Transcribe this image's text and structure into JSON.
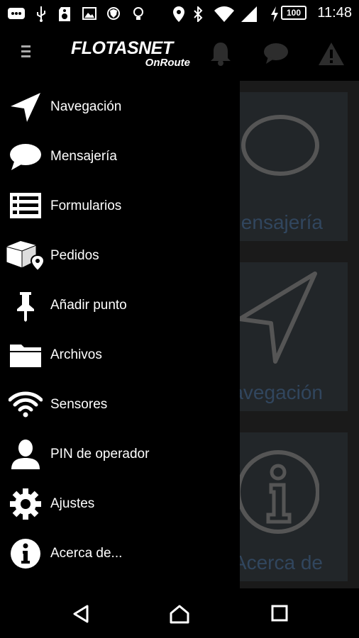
{
  "status_bar": {
    "time": "11:48",
    "battery": "100",
    "icons": [
      "messenger-icon",
      "usb-icon",
      "sd-card-icon",
      "image-icon",
      "shield-icon",
      "lightbulb-icon",
      "location-icon",
      "bluetooth-icon",
      "wifi-icon",
      "signal-icon",
      "charging-icon"
    ]
  },
  "app_bar": {
    "logo_main": "FLOTASNET",
    "logo_sub": "OnRoute",
    "icons": [
      "menu-icon",
      "bell-icon",
      "chat-icon",
      "warning-icon"
    ]
  },
  "drawer": {
    "items": [
      {
        "label": "Navegación",
        "icon": "navigation-arrow-icon"
      },
      {
        "label": "Mensajería",
        "icon": "chat-bubble-icon"
      },
      {
        "label": "Formularios",
        "icon": "form-list-icon"
      },
      {
        "label": "Pedidos",
        "icon": "package-location-icon"
      },
      {
        "label": "Añadir punto",
        "icon": "pin-icon"
      },
      {
        "label": "Archivos",
        "icon": "folder-icon"
      },
      {
        "label": "Sensores",
        "icon": "wifi-sensor-icon"
      },
      {
        "label": "PIN de operador",
        "icon": "user-icon"
      },
      {
        "label": "Ajustes",
        "icon": "gear-icon"
      },
      {
        "label": "Acerca de...",
        "icon": "info-icon"
      }
    ]
  },
  "background_cards": [
    {
      "label": "Mensajería",
      "icon": "chat-bubble-icon"
    },
    {
      "label": "Navegación",
      "icon": "navigation-arrow-icon"
    },
    {
      "label": "Acerca de",
      "icon": "info-icon"
    }
  ],
  "nav_bar": {
    "icons": [
      "back-icon",
      "home-icon",
      "recents-icon"
    ]
  },
  "colors": {
    "background": "#000000",
    "card": "#222629",
    "card_label": "#31465e",
    "drawer_text": "#ffffff"
  }
}
